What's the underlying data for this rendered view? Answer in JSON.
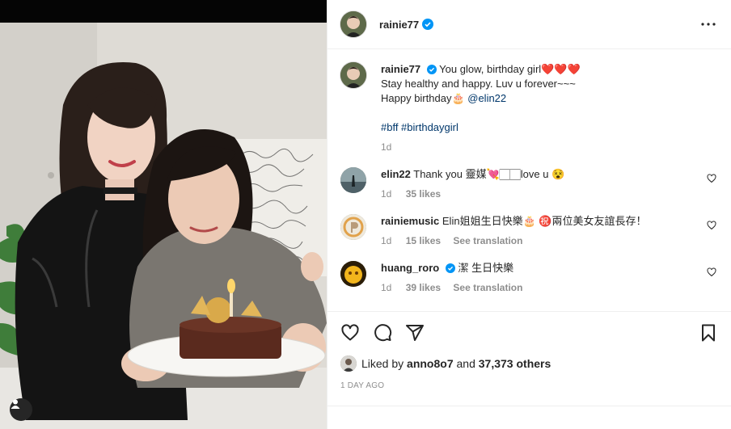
{
  "post": {
    "username": "rainie77",
    "more_icon": "more-horizontal-icon",
    "caption": {
      "username": "rainie77",
      "line1": "You glow, birthday girl❤️❤️❤️",
      "line2": "Stay healthy and happy. Luv u forever~~~",
      "line3_prefix": "Happy birthday🎂 ",
      "mention": "@elin22",
      "hashtags": "#bff #birthdaygirl",
      "time": "1d"
    },
    "comments": [
      {
        "username": "elin22",
        "text": "Thank you 靈媒💘🏻🏻love u 😵",
        "time": "1d",
        "likes": "35 likes",
        "translate": ""
      },
      {
        "username": "rainiemusic",
        "text": "Elin姐姐生日快樂🎂 ㊗️兩位美女友誼長存！",
        "time": "1d",
        "likes": "15 likes",
        "translate": "See translation"
      },
      {
        "username": "huang_roro",
        "text": "潔 生日快樂",
        "time": "1d",
        "likes": "39 likes",
        "translate": "See translation"
      }
    ],
    "liked_by": {
      "prefix": "Liked by ",
      "user": "anno8o7",
      "middle": " and ",
      "count": "37,373 others"
    },
    "date": "1 DAY AGO"
  },
  "colors": {
    "verified": "#0095f6",
    "hashtag": "#00376b",
    "muted": "#8e8e8e"
  }
}
